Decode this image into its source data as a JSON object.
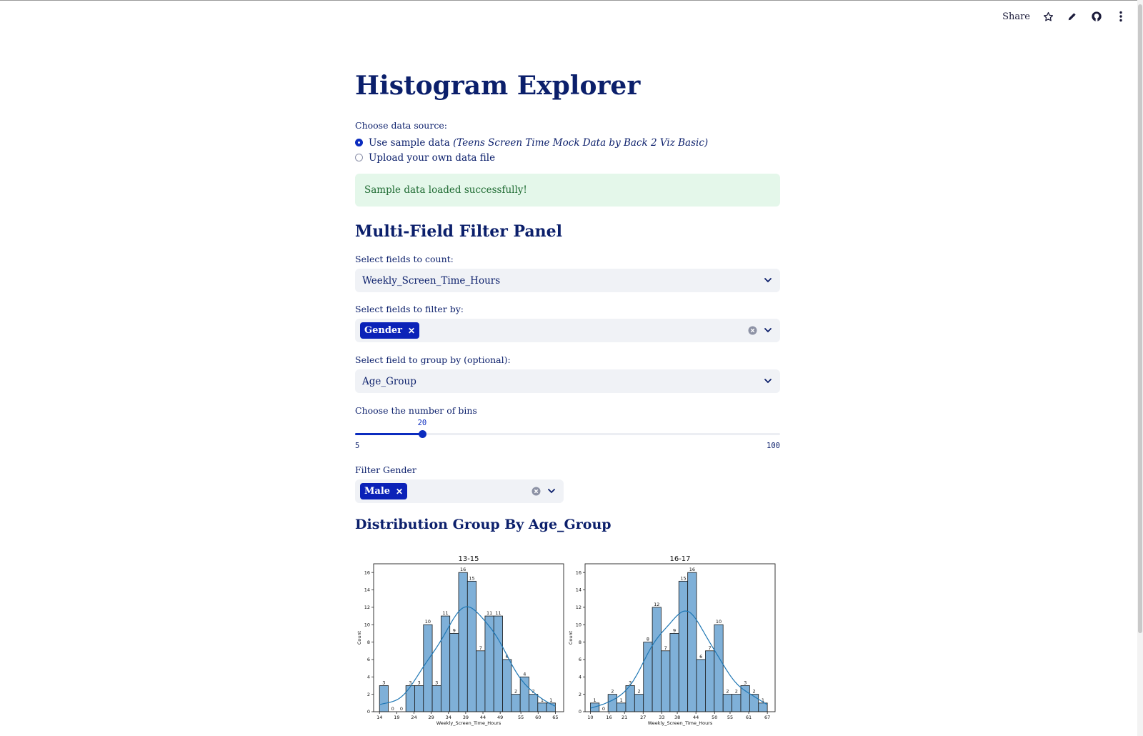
{
  "toolbar": {
    "share_label": "Share",
    "icons": [
      "star-icon",
      "pencil-icon",
      "github-icon",
      "more-vertical-icon"
    ]
  },
  "page": {
    "title": "Histogram Explorer"
  },
  "data_source": {
    "label": "Choose data source:",
    "options": [
      {
        "label": "Use sample data ",
        "label_italic": "(Teens Screen Time Mock Data by Back 2 Viz Basic)",
        "selected": true
      },
      {
        "label": "Upload your own data file",
        "selected": false
      }
    ],
    "success_message": "Sample data loaded successfully!"
  },
  "filter_panel": {
    "heading": "Multi-Field Filter Panel",
    "count_fields": {
      "label": "Select fields to count:",
      "value": "Weekly_Screen_Time_Hours"
    },
    "filter_fields": {
      "label": "Select fields to filter by:",
      "tags": [
        "Gender"
      ]
    },
    "group_field": {
      "label": "Select field to group by (optional):",
      "value": "Age_Group"
    },
    "bins": {
      "label": "Choose the number of bins",
      "value": 20,
      "min": 5,
      "max": 100
    },
    "filter_gender": {
      "label": "Filter Gender",
      "tags": [
        "Male"
      ]
    }
  },
  "distribution": {
    "heading": "Distribution Group By Age_Group"
  },
  "colors": {
    "accent": "#0b2cbf",
    "bar_fill": "#7fb0d8",
    "kde_line": "#1f77b4",
    "success_bg": "#e4f7ea"
  },
  "chart_data": [
    {
      "type": "bar",
      "title": "13-15",
      "xlabel": "Weekly_Screen_Time_Hours",
      "ylabel": "Count",
      "ylim": [
        0,
        17
      ],
      "xlim": [
        12.3,
        67.4
      ],
      "bin_start": 14,
      "bin_width": 2.55,
      "values": [
        3,
        0,
        0,
        3,
        3,
        10,
        3,
        11,
        9,
        16,
        15,
        7,
        11,
        11,
        6,
        2,
        4,
        2,
        1,
        1
      ],
      "x_ticks": [
        14,
        19,
        24,
        29,
        34,
        39,
        44,
        49,
        55,
        60,
        65
      ],
      "y_ticks": [
        0,
        2,
        4,
        6,
        8,
        10,
        12,
        14,
        16
      ],
      "kde": true
    },
    {
      "type": "bar",
      "title": "16-17",
      "xlabel": "Weekly_Screen_Time_Hours",
      "ylabel": "Count",
      "ylim": [
        0,
        17
      ],
      "xlim": [
        8.3,
        69.5
      ],
      "bin_start": 10,
      "bin_width": 2.85,
      "values": [
        1,
        0,
        2,
        1,
        3,
        2,
        8,
        12,
        7,
        9,
        15,
        16,
        6,
        7,
        10,
        2,
        2,
        3,
        2,
        1
      ],
      "x_ticks": [
        10,
        16,
        21,
        27,
        33,
        38,
        44,
        50,
        55,
        61,
        67
      ],
      "y_ticks": [
        0,
        2,
        4,
        6,
        8,
        10,
        12,
        14,
        16
      ],
      "kde": true
    }
  ]
}
